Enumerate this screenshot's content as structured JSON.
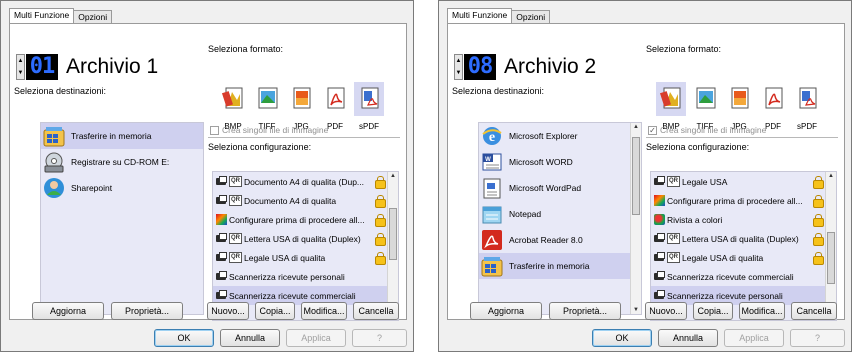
{
  "colors": {
    "lcd_digits": "#2d6cff",
    "selection": "#cfd0ef",
    "list_bg": "#e8e9f7",
    "lock": "#f6c21a"
  },
  "dialogs": [
    {
      "tabs": [
        "Multi Funzione",
        "Opzioni"
      ],
      "counter": "01",
      "name": "Archivio 1",
      "dest_label": "Seleziona destinazioni:",
      "destinations": [
        {
          "label": "Trasferire in memoria",
          "icon": "memory-transfer-icon",
          "selected": true
        },
        {
          "label": "Registrare su CD-ROM  E:",
          "icon": "cd-rom-icon",
          "selected": false
        },
        {
          "label": "Sharepoint",
          "icon": "sharepoint-icon",
          "selected": false
        }
      ],
      "format_label": "Seleziona formato:",
      "formats": [
        {
          "label": "BMP",
          "icon": "bmp-icon"
        },
        {
          "label": "TIFF",
          "icon": "tiff-icon"
        },
        {
          "label": "JPG",
          "icon": "jpg-icon"
        },
        {
          "label": "PDF",
          "icon": "pdf-icon"
        },
        {
          "label": "sPDF",
          "icon": "spdf-icon",
          "selected": true
        }
      ],
      "single_files": "Crea singoli file di immagine",
      "single_checked": false,
      "config_label": "Seleziona configurazione:",
      "configs": [
        {
          "label": "Documento A4 di qualita (Dup...",
          "icon": "scan-quality",
          "lock": true
        },
        {
          "label": "Documento A4 di qualita",
          "icon": "scan-quality",
          "lock": true
        },
        {
          "label": "Configurare prima di procedere all...",
          "icon": "image",
          "lock": true
        },
        {
          "label": "Lettera USA di qualita (Duplex)",
          "icon": "scan-quality",
          "lock": true
        },
        {
          "label": "Legale USA di qualita",
          "icon": "scan-quality",
          "lock": true
        },
        {
          "label": "Scannerizza ricevute personali",
          "icon": "scan",
          "lock": false
        },
        {
          "label": "Scannerizza ricevute commerciali",
          "icon": "scan",
          "lock": false,
          "selected": true
        }
      ],
      "buttons": {
        "refresh": "Aggiorna",
        "properties": "Proprietà...",
        "new": "Nuovo...",
        "copy": "Copia...",
        "edit": "Modifica...",
        "delete": "Cancella"
      },
      "footer": {
        "ok": "OK",
        "cancel": "Annulla",
        "apply": "Applica",
        "help": "?"
      }
    },
    {
      "tabs": [
        "Multi Funzione",
        "Opzioni"
      ],
      "counter": "08",
      "name": "Archivio 2",
      "dest_label": "Seleziona destinazioni:",
      "destinations": [
        {
          "label": "Microsoft Explorer",
          "icon": "explorer-icon",
          "selected": false
        },
        {
          "label": "Microsoft WORD",
          "icon": "word-icon",
          "selected": false
        },
        {
          "label": "Microsoft WordPad",
          "icon": "wordpad-icon",
          "selected": false
        },
        {
          "label": "Notepad",
          "icon": "notepad-icon",
          "selected": false
        },
        {
          "label": "Acrobat Reader 8.0",
          "icon": "acrobat-icon",
          "selected": false
        },
        {
          "label": "Trasferire in memoria",
          "icon": "memory-transfer-icon",
          "selected": true
        }
      ],
      "format_label": "Seleziona formato:",
      "formats": [
        {
          "label": "BMP",
          "icon": "bmp-icon",
          "selected": true
        },
        {
          "label": "TIFF",
          "icon": "tiff-icon"
        },
        {
          "label": "JPG",
          "icon": "jpg-icon"
        },
        {
          "label": "PDF",
          "icon": "pdf-icon"
        },
        {
          "label": "sPDF",
          "icon": "spdf-icon"
        }
      ],
      "single_files": "Crea singoli file di immagine",
      "single_checked": true,
      "config_label": "Seleziona configurazione:",
      "configs": [
        {
          "label": "Legale USA",
          "icon": "scan-quality",
          "lock": true
        },
        {
          "label": "Configurare prima di procedere all...",
          "icon": "image",
          "lock": true
        },
        {
          "label": "Rivista a colori",
          "icon": "magazine",
          "lock": true
        },
        {
          "label": "Lettera USA di qualita (Duplex)",
          "icon": "scan-quality",
          "lock": true
        },
        {
          "label": "Legale USA di qualita",
          "icon": "scan-quality",
          "lock": true
        },
        {
          "label": "Scannerizza ricevute commerciali",
          "icon": "scan",
          "lock": false
        },
        {
          "label": "Scannerizza ricevute personali",
          "icon": "scan",
          "lock": false,
          "selected": true
        }
      ],
      "buttons": {
        "refresh": "Aggiorna",
        "properties": "Proprietà...",
        "new": "Nuovo...",
        "copy": "Copia...",
        "edit": "Modifica...",
        "delete": "Cancella"
      },
      "footer": {
        "ok": "OK",
        "cancel": "Annulla",
        "apply": "Applica",
        "help": "?"
      }
    }
  ]
}
